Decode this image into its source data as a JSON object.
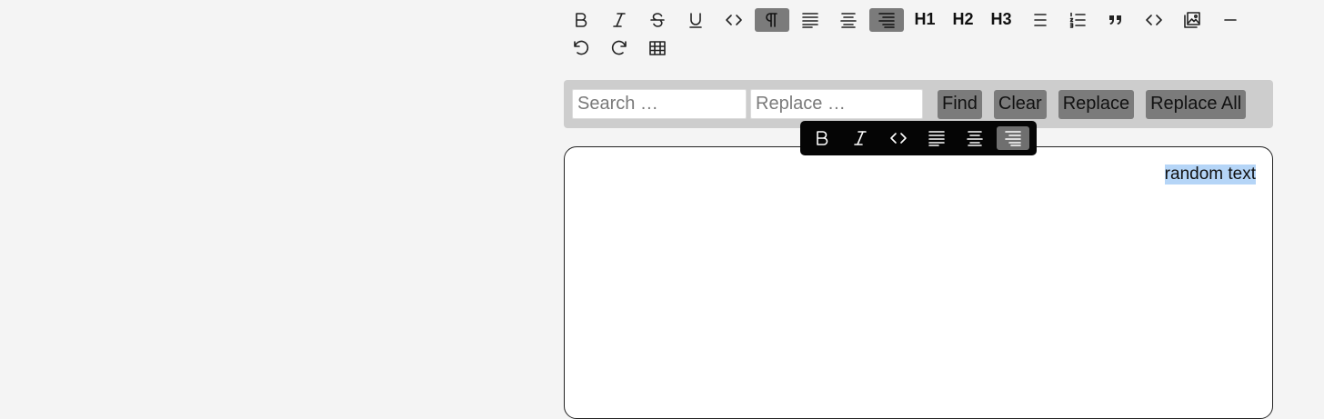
{
  "toolbar": {
    "row1": [
      {
        "icon": "bold-icon"
      },
      {
        "icon": "italic-icon"
      },
      {
        "icon": "strikethrough-icon"
      },
      {
        "icon": "underline-icon"
      },
      {
        "icon": "code-icon"
      },
      {
        "icon": "paragraph-icon",
        "active": true
      },
      {
        "icon": "align-left-icon"
      },
      {
        "icon": "align-center-icon"
      },
      {
        "icon": "align-right-icon",
        "active": true
      },
      {
        "label": "H1"
      },
      {
        "label": "H2"
      },
      {
        "label": "H3"
      },
      {
        "icon": "bullet-list-icon"
      },
      {
        "icon": "ordered-list-icon"
      },
      {
        "icon": "blockquote-icon"
      },
      {
        "icon": "code-block-icon"
      },
      {
        "icon": "image-icon"
      },
      {
        "icon": "horizontal-rule-icon"
      }
    ],
    "row2": [
      {
        "icon": "undo-icon"
      },
      {
        "icon": "redo-icon"
      },
      {
        "icon": "table-icon"
      }
    ],
    "h1": "H1",
    "h2": "H2",
    "h3": "H3"
  },
  "search": {
    "search_placeholder": "Search …",
    "replace_placeholder": "Replace …",
    "find_label": "Find",
    "clear_label": "Clear",
    "replace_label": "Replace",
    "replace_all_label": "Replace All"
  },
  "bubble_menu": [
    {
      "icon": "bold-icon"
    },
    {
      "icon": "italic-icon"
    },
    {
      "icon": "code-icon"
    },
    {
      "icon": "align-left-icon"
    },
    {
      "icon": "align-center-icon"
    },
    {
      "icon": "align-right-icon",
      "active": true
    }
  ],
  "editor": {
    "content": "random text"
  },
  "colors": {
    "active_button": "#7b7b7b",
    "selection": "#b5d5f7",
    "bubble_bg": "#050505",
    "search_bar_bg": "#cdcdcd"
  }
}
